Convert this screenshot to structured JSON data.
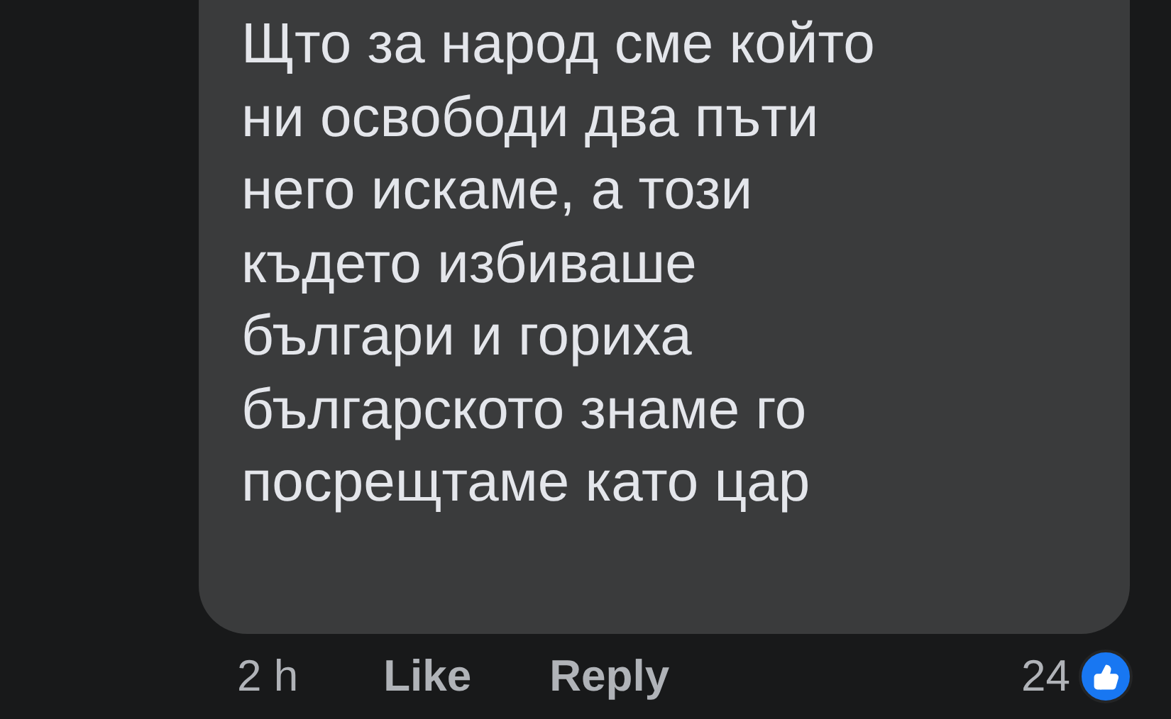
{
  "comment": {
    "text": "Щто за народ сме който\nни освободи два пъти\nнего искаме, а този\nкъдето избиваше\nбългари и гориха\nбългарското знаме го\nпосрещтаме като цар"
  },
  "actions": {
    "time": "2 h",
    "like": "Like",
    "reply": "Reply",
    "reaction_count": "24"
  }
}
